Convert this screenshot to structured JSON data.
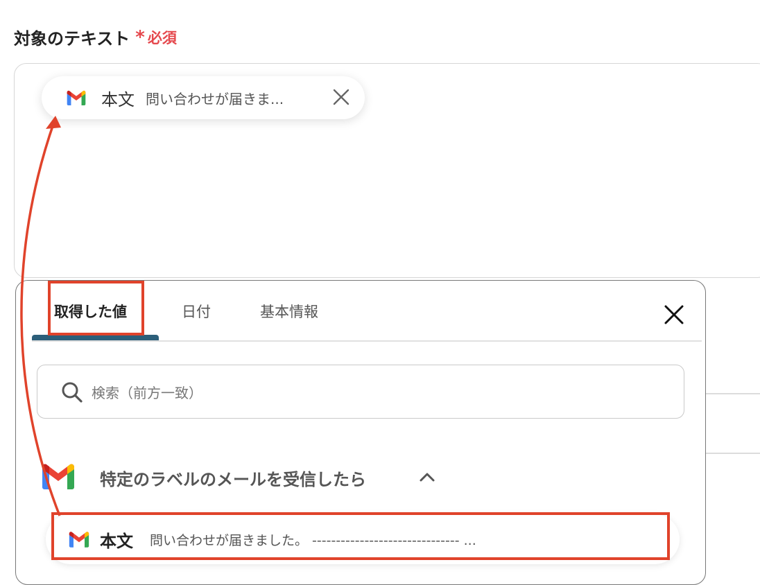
{
  "field": {
    "label": "対象のテキスト",
    "required_star": "*",
    "required_text": "必須"
  },
  "selected_chip": {
    "icon": "gmail-icon",
    "title": "本文",
    "value": "問い合わせが届きま..."
  },
  "panel": {
    "tabs": [
      {
        "label": "取得した値",
        "active": true
      },
      {
        "label": "日付",
        "active": false
      },
      {
        "label": "基本情報",
        "active": false
      }
    ],
    "search": {
      "placeholder": "検索（前方一致）",
      "value": ""
    },
    "group": {
      "icon": "gmail-icon",
      "title": "特定のラベルのメールを受信したら",
      "expanded": true
    },
    "items": [
      {
        "icon": "gmail-icon",
        "title": "本文",
        "value": "問い合わせが届きました。 ------------------------------- ..."
      }
    ]
  },
  "colors": {
    "required": "#e5484d",
    "active_tab_underline": "#2c5f7a",
    "annotation": "#e0432b"
  }
}
